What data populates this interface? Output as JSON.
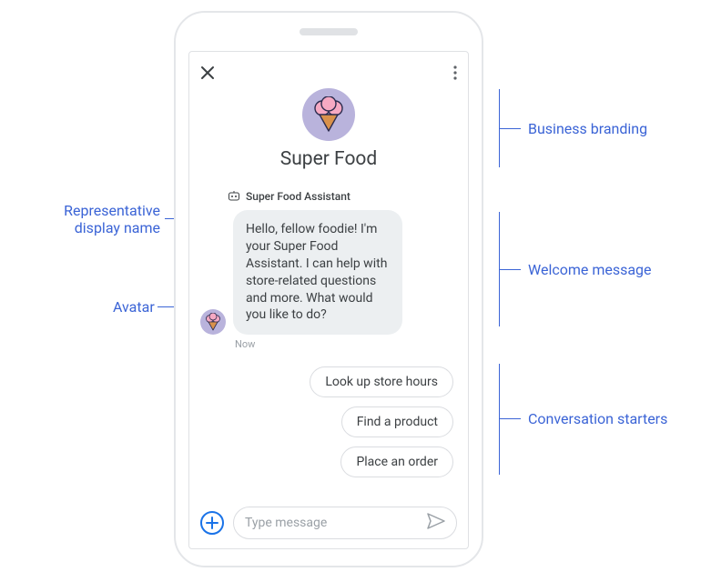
{
  "brand": {
    "name": "Super Food"
  },
  "representative": {
    "display_name": "Super Food Assistant"
  },
  "welcome": {
    "text": "Hello, fellow foodie! I'm your Super Food Assistant. I can help with store-related questions and more. What would you like to do?",
    "timestamp": "Now"
  },
  "starters": [
    "Look up store hours",
    "Find a product",
    "Place an order"
  ],
  "composer": {
    "placeholder": "Type message"
  },
  "annotations": {
    "branding": "Business branding",
    "rep_name": "Representative display name",
    "avatar": "Avatar",
    "welcome": "Welcome message",
    "starters": "Conversation starters"
  }
}
